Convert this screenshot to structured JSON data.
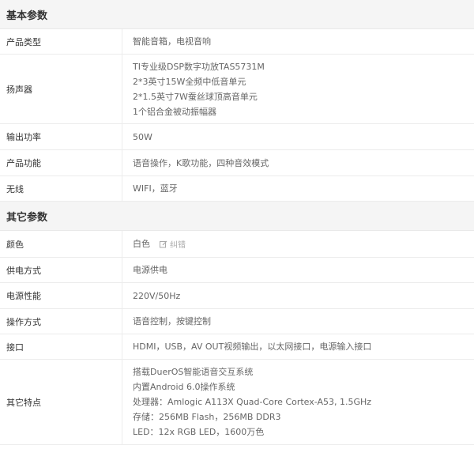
{
  "sections": [
    {
      "title": "基本参数",
      "rows": [
        {
          "label": "产品类型",
          "lines": [
            "智能音箱，电视音响"
          ]
        },
        {
          "label": "扬声器",
          "lines": [
            "TI专业级DSP数字功放TAS5731M",
            "2*3英寸15W全频中低音单元",
            "2*1.5英寸7W蚕丝球顶高音单元",
            "1个铝合金被动振幅器"
          ]
        },
        {
          "label": "输出功率",
          "lines": [
            "50W"
          ]
        },
        {
          "label": "产品功能",
          "lines": [
            "语音操作，K歌功能，四种音效模式"
          ]
        },
        {
          "label": "无线",
          "lines": [
            "WIFI，蓝牙"
          ]
        }
      ]
    },
    {
      "title": "其它参数",
      "rows": [
        {
          "label": "颜色",
          "lines": [
            "白色"
          ],
          "correct_label": "纠错",
          "correct_icon": "edit-icon"
        },
        {
          "label": "供电方式",
          "lines": [
            "电源供电"
          ]
        },
        {
          "label": "电源性能",
          "lines": [
            "220V/50Hz"
          ]
        },
        {
          "label": "操作方式",
          "lines": [
            "语音控制，按键控制"
          ]
        },
        {
          "label": "接口",
          "lines": [
            "HDMI，USB，AV OUT视频输出，以太网接口，电源输入接口"
          ]
        },
        {
          "label": "其它特点",
          "lines": [
            "搭载DuerOS智能语音交互系统",
            "内置Android 6.0操作系统",
            "处理器：Amlogic A113X Quad-Core Cortex-A53, 1.5GHz",
            "存储：256MB Flash，256MB DDR3",
            "LED：12x RGB LED，1600万色"
          ]
        }
      ]
    }
  ]
}
